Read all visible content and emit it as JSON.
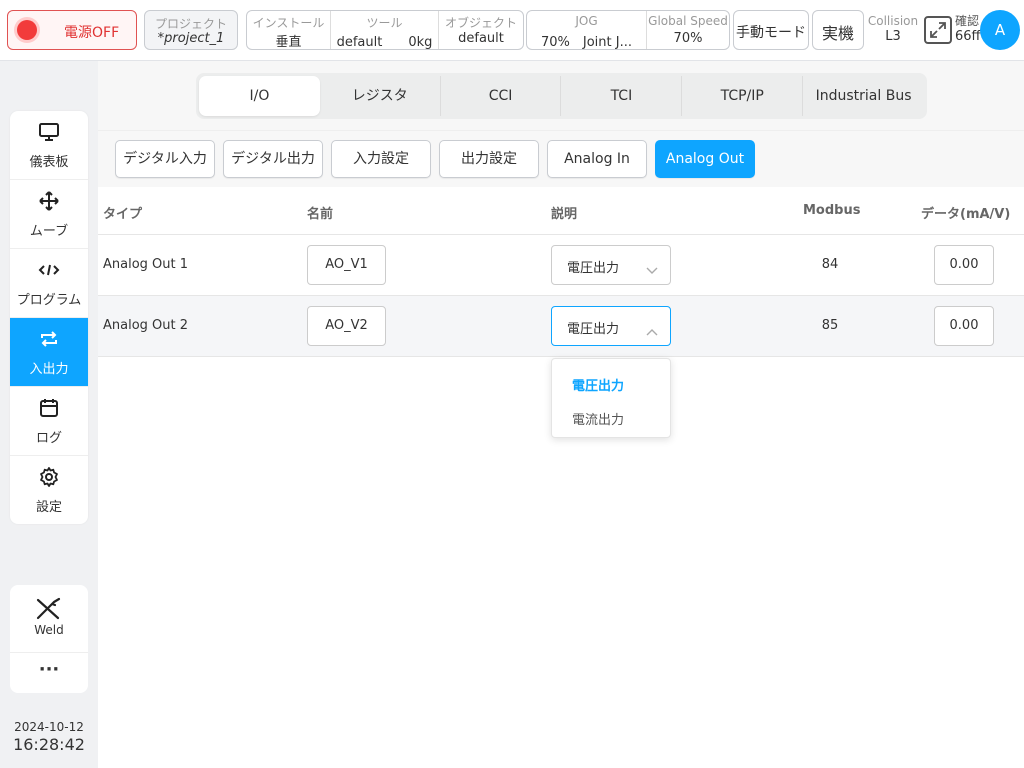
{
  "topbar": {
    "power_label": "電源OFF",
    "project": {
      "label": "プロジェクト",
      "value": "*project_1"
    },
    "install": [
      {
        "label": "インストール",
        "value": "垂直"
      },
      {
        "label": "ツール",
        "value": "default　　0kg"
      },
      {
        "label": "オブジェクト",
        "value": "default"
      }
    ],
    "jog": [
      {
        "label": "JOG",
        "value": "70%　Joint J..."
      },
      {
        "label": "Global Speed",
        "value": "70%"
      }
    ],
    "manual_mode": "手動モード",
    "real_machine": "実機",
    "collision": {
      "label": "Collision",
      "value": "L3"
    },
    "confirm": {
      "label": "確認",
      "value": "66ff"
    },
    "avatar": "A"
  },
  "sidebar": {
    "items": [
      {
        "label": "儀表板",
        "icon": "monitor-icon"
      },
      {
        "label": "ムーブ",
        "icon": "move-arrows-icon"
      },
      {
        "label": "プログラム",
        "icon": "code-icon"
      },
      {
        "label": "入出力",
        "icon": "swap-arrows-icon",
        "active": true
      },
      {
        "label": "ログ",
        "icon": "calendar-icon"
      },
      {
        "label": "設定",
        "icon": "gear-icon"
      }
    ],
    "weld_label": "Weld",
    "more_label": "···",
    "date": "2024-10-12",
    "time": "16:28:42"
  },
  "tabs": [
    "I/O",
    "レジスタ",
    "CCI",
    "TCI",
    "TCP/IP",
    "Industrial Bus"
  ],
  "subtabs": [
    "デジタル入力",
    "デジタル出力",
    "入力設定",
    "出力設定",
    "Analog In",
    "Analog Out"
  ],
  "table": {
    "headers": {
      "type": "タイプ",
      "name": "名前",
      "desc": "説明",
      "modbus": "Modbus",
      "data": "データ(mA/V)"
    },
    "rows": [
      {
        "type": "Analog Out 1",
        "name": "AO_V1",
        "desc": "電圧出力",
        "modbus": "84",
        "data": "0.00"
      },
      {
        "type": "Analog Out 2",
        "name": "AO_V2",
        "desc": "電圧出力",
        "modbus": "85",
        "data": "0.00"
      }
    ]
  },
  "dropdown": {
    "options": [
      "電圧出力",
      "電流出力"
    ],
    "selected": "電圧出力"
  },
  "colors": {
    "accent": "#0ea5ff",
    "power_red": "#f23b3b"
  }
}
